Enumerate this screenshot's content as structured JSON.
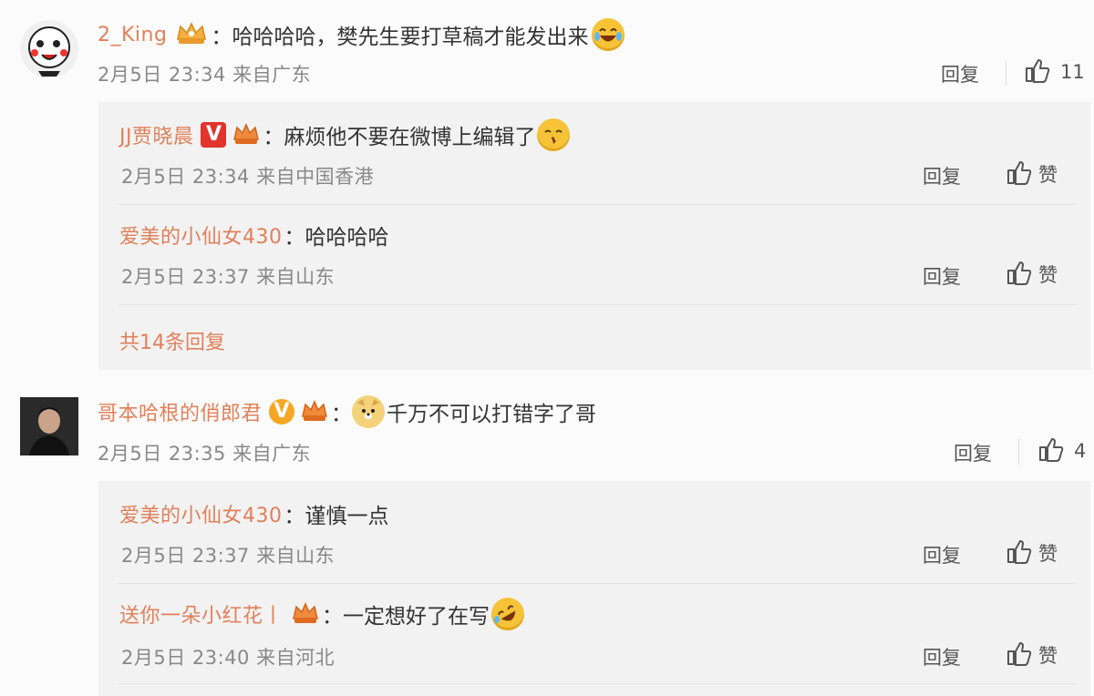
{
  "comments": [
    {
      "user": "2_King",
      "text": "：哈哈哈哈，樊先生要打草稿才能发出来",
      "time": "2月5日 23:34 来自广东",
      "reply_label": "回复",
      "like_count": "11",
      "replies": [
        {
          "user": "JJ贾晓晨",
          "text": "：麻烦他不要在微博上编辑了",
          "time": "2月5日 23:34 来自中国香港",
          "reply_label": "回复",
          "like_label": "赞"
        },
        {
          "user": "爱美的小仙女430",
          "text": "：哈哈哈哈",
          "time": "2月5日 23:37 来自山东",
          "reply_label": "回复",
          "like_label": "赞"
        }
      ],
      "more_replies": "共14条回复"
    },
    {
      "user": "哥本哈根的俏郎君",
      "text": "千万不可以打错字了哥",
      "colon": "：",
      "time": "2月5日 23:35 来自广东",
      "reply_label": "回复",
      "like_count": "4",
      "replies": [
        {
          "user": "爱美的小仙女430",
          "text": "：谨慎一点",
          "time": "2月5日 23:37 来自山东",
          "reply_label": "回复",
          "like_label": "赞"
        },
        {
          "user": "送你一朵小红花丨",
          "text": "：一定想好了在写",
          "time": "2月5日 23:40 来自河北",
          "reply_label": "回复",
          "like_label": "赞"
        }
      ]
    }
  ],
  "colors": {
    "username": "#e0805a",
    "meta": "#888888",
    "reply_bg": "#f2f2f2",
    "vip_red": "#e0342c",
    "vip_orange": "#f5a623"
  }
}
